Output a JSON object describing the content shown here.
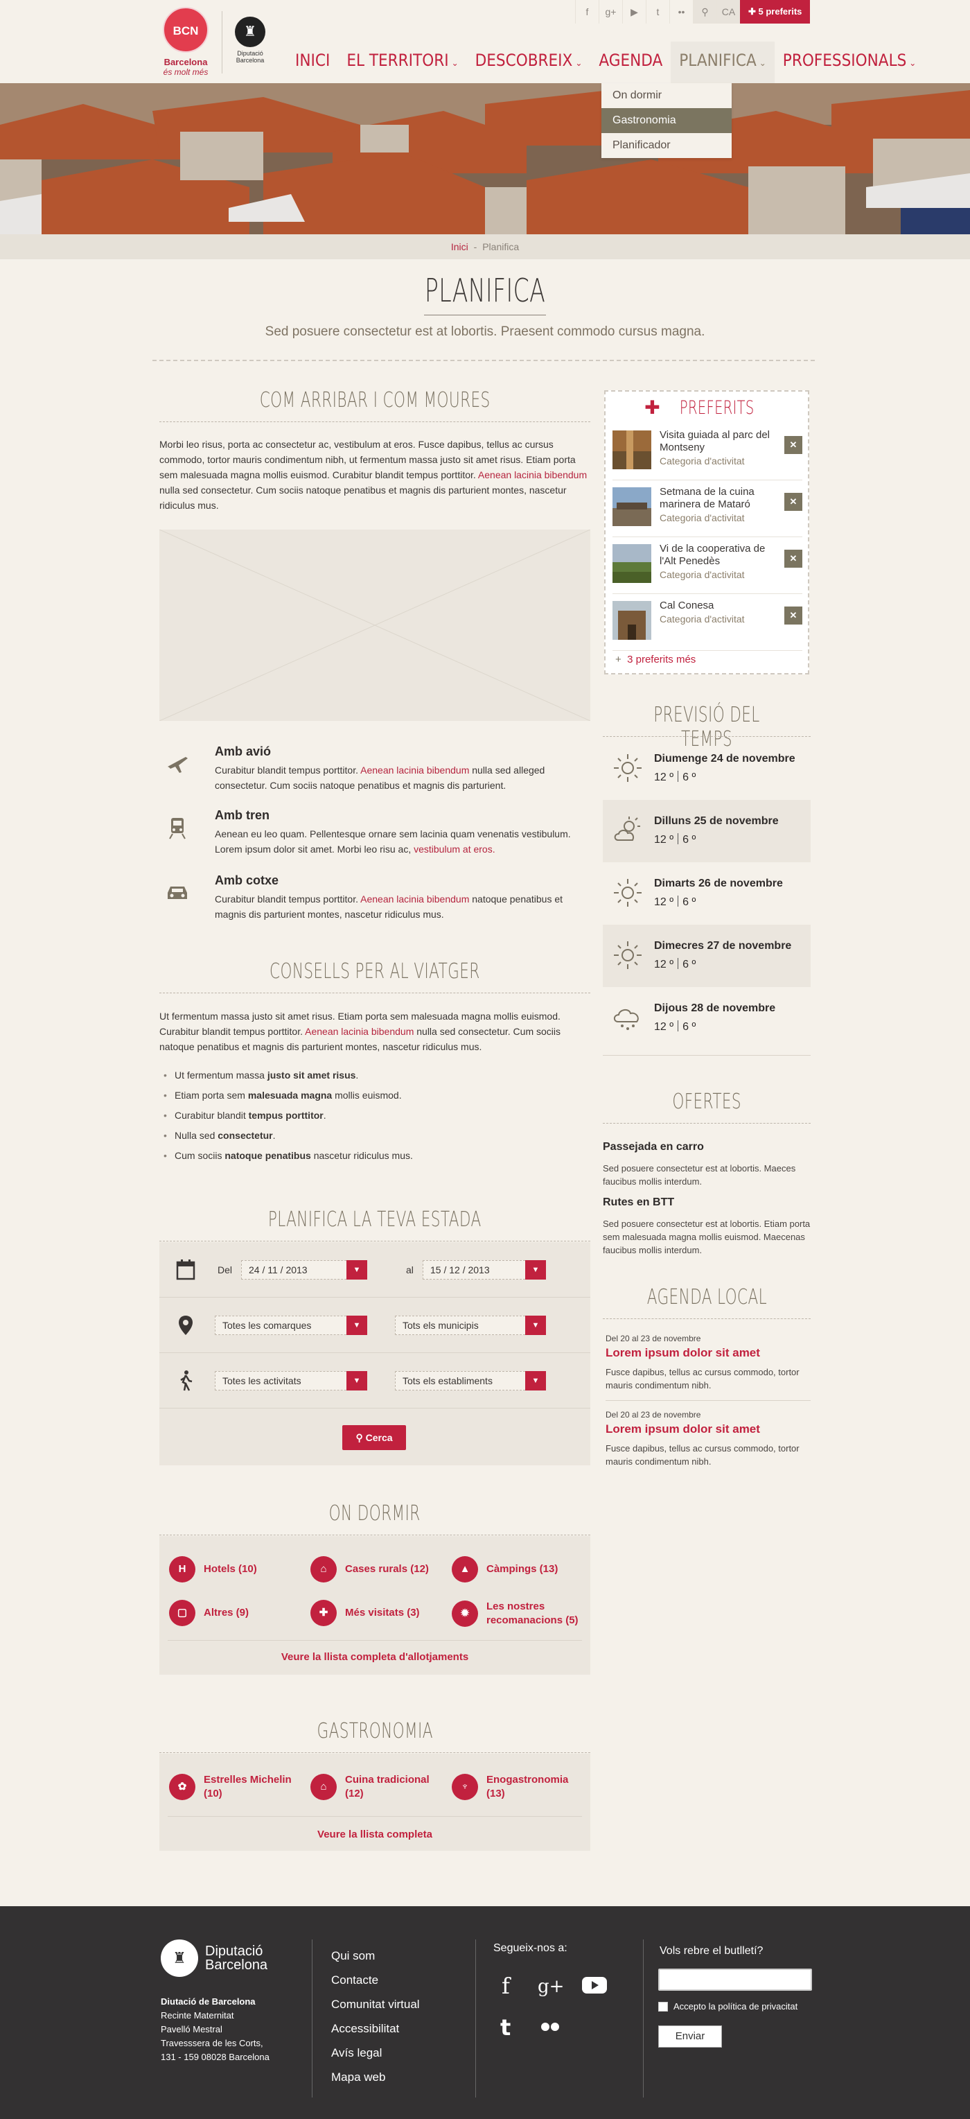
{
  "header": {
    "logo_bcn_mark": "BCN",
    "logo_bcn_line1": "Barcelona",
    "logo_bcn_line2": "és molt més",
    "logo_dip_line1": "Diputació",
    "logo_dip_line2": "Barcelona",
    "topbar": {
      "icons": [
        "facebook-icon",
        "google-plus-icon",
        "youtube-icon",
        "tumblr-icon",
        "flickr-icon",
        "search-icon"
      ],
      "lang": "CA",
      "favorites": "5 preferits"
    },
    "nav": [
      {
        "label": "INICI"
      },
      {
        "label": "EL TERRITORI"
      },
      {
        "label": "DESCOBREIX"
      },
      {
        "label": "AGENDA"
      },
      {
        "label": "PLANIFICA"
      },
      {
        "label": "PROFESSIONALS"
      }
    ],
    "dropdown": [
      "On dormir",
      "Gastronomia",
      "Planificador"
    ]
  },
  "breadcrumb": {
    "home": "Inici",
    "sep": "-",
    "current": "Planifica"
  },
  "page": {
    "title": "PLANIFICA",
    "subtitle": "Sed posuere consectetur est at lobortis. Praesent commodo cursus magna."
  },
  "arribar": {
    "title": "COM ARRIBAR I COM MOURES",
    "p1": "Morbi leo risus, porta ac consectetur ac, vestibulum at eros. Fusce dapibus, tellus ac cursus commodo, tortor mauris condimentum nibh, ut fermentum massa justo sit amet risus. Etiam porta sem malesuada magna mollis euismod. Curabitur blandit tempus porttitor.",
    "p1_link": "Aenean lacinia bibendum",
    "p1_end": "nulla sed consectetur. Cum sociis natoque penatibus et magnis dis parturient montes, nascetur ridiculus mus.",
    "items": [
      {
        "title": "Amb avió",
        "t1": "Curabitur blandit tempus porttitor.",
        "link": "Aenean lacinia bibendum",
        "t2": "nulla sed alleged consectetur. Cum sociis natoque penatibus et magnis dis parturient."
      },
      {
        "title": "Amb tren",
        "t1": "Aenean eu leo quam. Pellentesque ornare sem lacinia quam venenatis vestibulum. Lorem ipsum dolor sit amet. Morbi leo risu ac,",
        "link": "vestibulum at eros.",
        "t2": ""
      },
      {
        "title": "Amb cotxe",
        "t1": "Curabitur blandit tempus porttitor.",
        "link": "Aenean lacinia bibendum",
        "t2": "natoque penatibus et magnis dis parturient montes, nascetur ridiculus mus."
      }
    ]
  },
  "consells": {
    "title": "CONSELLS PER AL VIATGER",
    "p1": "Ut fermentum massa justo sit amet risus. Etiam porta sem malesuada magna mollis euismod. Curabitur blandit tempus porttitor.",
    "link": "Aenean lacinia bibendum",
    "p1_end": "nulla sed consectetur. Cum sociis natoque penatibus et magnis dis parturient montes, nascetur ridiculus mus.",
    "list": [
      {
        "a": "Ut fermentum massa ",
        "b": "justo sit amet risus",
        "c": "."
      },
      {
        "a": "Etiam porta sem ",
        "b": "malesuada magna",
        "c": " mollis euismod."
      },
      {
        "a": "Curabitur blandit ",
        "b": "tempus porttitor",
        "c": "."
      },
      {
        "a": "Nulla sed ",
        "b": "consectetur",
        "c": "."
      },
      {
        "a": "Cum sociis ",
        "b": "natoque penatibus",
        "c": " nascetur ridiculus mus."
      }
    ]
  },
  "estada": {
    "title": "PLANIFICA LA TEVA ESTADA",
    "from_label": "Del",
    "from": "24 / 11 / 2013",
    "to_label": "al",
    "to": "15 / 12 / 2013",
    "comarques": "Totes les comarques",
    "municipis": "Tots els municipis",
    "activitats": "Totes les activitats",
    "establiments": "Tots els establiments",
    "search": "Cerca"
  },
  "dormir": {
    "title": "ON DORMIR",
    "cats": [
      {
        "icon": "H",
        "label": "Hotels (10)"
      },
      {
        "icon": "⌂",
        "label": "Cases rurals (12)"
      },
      {
        "icon": "▲",
        "label": "Càmpings (13)"
      },
      {
        "icon": "▢",
        "label": "Altres (9)"
      },
      {
        "icon": "✚",
        "label": "Més visitats (3)"
      },
      {
        "icon": "✹",
        "label": "Les nostres recomanacions (5)"
      }
    ],
    "more": "Veure la llista completa d'allotjaments"
  },
  "gastro": {
    "title": "GASTRONOMIA",
    "cats": [
      {
        "icon": "✿",
        "label": "Estrelles Michelin (10)"
      },
      {
        "icon": "⌂",
        "label": "Cuina tradicional (12)"
      },
      {
        "icon": "♆",
        "label": "Enogastronomia (13)"
      }
    ],
    "more": "Veure la llista completa"
  },
  "preferits": {
    "title": "PREFERITS",
    "items": [
      {
        "name": "Visita guiada al parc del Montseny",
        "cat": "Categoria d'activitat"
      },
      {
        "name": "Setmana de la cuina marinera de Mataró",
        "cat": "Categoria d'activitat"
      },
      {
        "name": "Vi de la cooperativa de l'Alt Penedès",
        "cat": "Categoria d'activitat"
      },
      {
        "name": "Cal Conesa",
        "cat": "Categoria d'activitat"
      }
    ],
    "more": "3 preferits més"
  },
  "temps": {
    "title": "PREVISIÓ DEL TEMPS",
    "days": [
      {
        "day": "Diumenge 24 de novembre",
        "max": "12 º",
        "min": "6 º",
        "icon": "sun-icon"
      },
      {
        "day": "Dilluns 25 de novembre",
        "max": "12 º",
        "min": "6 º",
        "icon": "sun-cloud-icon"
      },
      {
        "day": "Dimarts 26 de novembre",
        "max": "12 º",
        "min": "6 º",
        "icon": "sun-icon"
      },
      {
        "day": "Dimecres 27 de novembre",
        "max": "12 º",
        "min": "6 º",
        "icon": "sun-icon"
      },
      {
        "day": "Dijous 28 de novembre",
        "max": "12 º",
        "min": "6 º",
        "icon": "rain-icon"
      }
    ]
  },
  "ofertes": {
    "title": "OFERTES",
    "items": [
      {
        "title": "Passejada en carro",
        "text": "Sed posuere consectetur est at lobortis. Maeces faucibus mollis interdum."
      },
      {
        "title": "Rutes en BTT",
        "text": "Sed posuere consectetur est at lobortis. Etiam porta sem malesuada magna mollis euismod. Maecenas faucibus mollis interdum."
      }
    ]
  },
  "agenda": {
    "title": "AGENDA LOCAL",
    "items": [
      {
        "date": "Del 20 al 23 de novembre",
        "title": "Lorem ipsum dolor sit amet",
        "text": "Fusce dapibus, tellus ac cursus commodo, tortor mauris condimentum nibh."
      },
      {
        "date": "Del 20 al 23 de novembre",
        "title": "Lorem ipsum dolor sit amet",
        "text": "Fusce dapibus, tellus ac cursus commodo, tortor mauris condimentum nibh."
      }
    ]
  },
  "footer": {
    "logo1": "Diputació",
    "logo2": "Barcelona",
    "addr_title": "Diutació de Barcelona",
    "addr": [
      "Recinte Maternitat",
      "Pavelló Mestral",
      "Travesssera de les Corts,",
      "131 - 159 08028 Barcelona"
    ],
    "links": [
      "Qui som",
      "Contacte",
      "Comunitat virtual",
      "Accessibilitat",
      "Avís legal",
      "Mapa web"
    ],
    "social_title": "Segueix-nos a:",
    "newsletter_title": "Vols rebre el butlletí?",
    "privacy": "Accepto la política de privacitat",
    "send": "Enviar"
  },
  "colors": {
    "accent": "#c1213e",
    "olive": "#7b7560",
    "bg": "#f5f1ea",
    "footer": "#333132"
  }
}
